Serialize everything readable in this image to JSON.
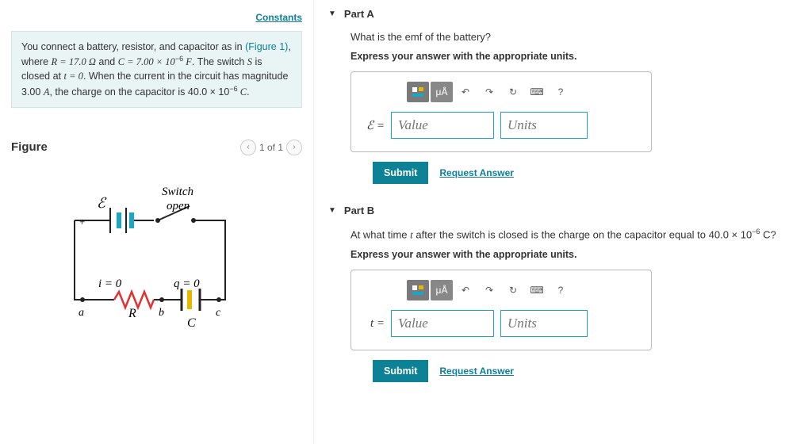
{
  "constants_link": "Constants",
  "problem": {
    "line1a": "You connect a battery, resistor, and capacitor as in",
    "fig_link": "(Figure 1)",
    "line1b": ", where ",
    "R_eq": "R = 17.0 Ω",
    "and": " and ",
    "C_eq": "C = 7.00 × 10",
    "C_exp": "−6",
    "C_unit": " F",
    "line2": ". The switch ",
    "S": "S",
    "line2b": " is closed at ",
    "t0": "t = 0",
    "line2c": ". When the current in the circuit has magnitude 3.00 ",
    "Aunit": "A",
    "line2d": ", the charge on the capacitor is 40.0 × 10",
    "q_exp": "−6",
    "q_unit": " C",
    "period": "."
  },
  "figure": {
    "heading": "Figure",
    "pager_text": "1 of 1",
    "switch_label": "Switch",
    "open_label": "open",
    "emf": "ℰ",
    "i0": "i = 0",
    "q0": "q = 0",
    "a": "a",
    "b": "b",
    "c": "c",
    "R": "R",
    "C": "C",
    "plus": "+"
  },
  "partA": {
    "title": "Part A",
    "question": "What is the emf of the battery?",
    "instruct": "Express your answer with the appropriate units.",
    "var": "ℰ =",
    "value_ph": "Value",
    "units_ph": "Units",
    "muA": "μÅ"
  },
  "partB": {
    "title": "Part B",
    "question_a": "At what time ",
    "t": "t",
    "question_b": " after the switch is closed is the charge on the capacitor equal to 40.0 × 10",
    "exp": "−6",
    "question_c": " C?",
    "instruct": "Express your answer with the appropriate units.",
    "var": "t =",
    "value_ph": "Value",
    "units_ph": "Units",
    "muA": "μÅ"
  },
  "common": {
    "submit": "Submit",
    "request": "Request Answer",
    "help": "?"
  }
}
